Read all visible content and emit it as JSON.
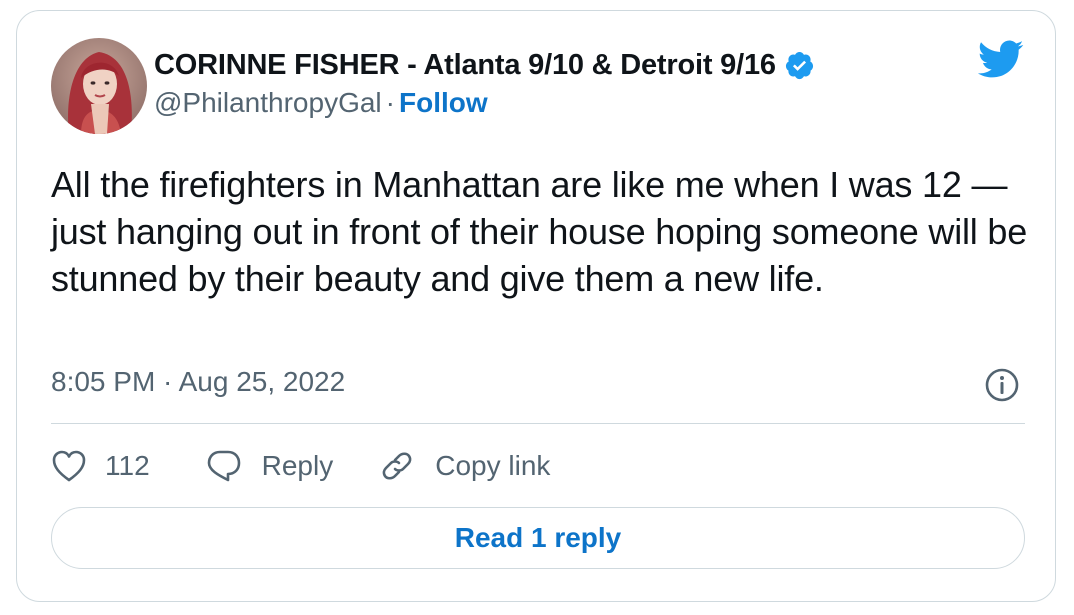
{
  "user": {
    "display_name": "CORINNE FISHER - Atlanta 9/10 & Detroit 9/16",
    "handle": "@PhilanthropyGal",
    "separator": "·",
    "follow_label": "Follow",
    "verified": true,
    "avatar_icon": "profile-photo"
  },
  "tweet": {
    "text": "All the firefighters in Manhattan are like me when I was 12 — just hanging out in front of their house hoping someone will be stunned by their beauty and give them a new life.",
    "timestamp": "8:05 PM · Aug 25, 2022"
  },
  "actions": {
    "like_count": "112",
    "reply_label": "Reply",
    "copy_link_label": "Copy link"
  },
  "read_replies_label": "Read 1 reply",
  "icons": {
    "brand": "twitter-bird-icon",
    "verified": "verified-badge-icon",
    "info": "info-icon",
    "like": "heart-icon",
    "reply": "speech-bubble-icon",
    "copy": "link-icon"
  },
  "colors": {
    "accent": "#1d9bf0",
    "link": "#0d74c9",
    "text": "#0f1419",
    "secondary_text": "#536471",
    "border": "#cfd9de"
  }
}
